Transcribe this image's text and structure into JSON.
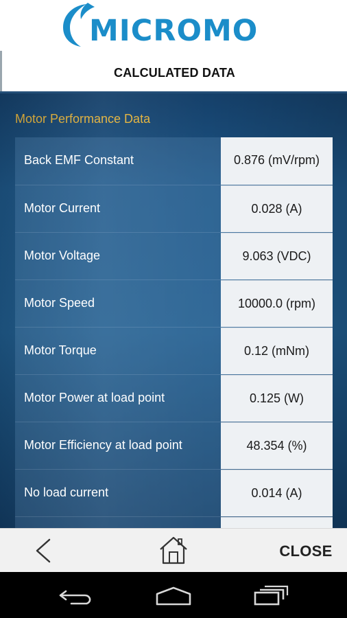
{
  "header": {
    "logo_text": "MICROMO",
    "brand_color": "#1b8dc9"
  },
  "titlebar": {
    "title": "CALCULATED DATA"
  },
  "section": {
    "title": "Motor Performance Data",
    "title_color": "#e4b33c"
  },
  "rows": [
    {
      "label": "Back EMF Constant",
      "value": "0.876 (mV/rpm)"
    },
    {
      "label": "Motor Current",
      "value": "0.028 (A)"
    },
    {
      "label": "Motor Voltage",
      "value": "9.063 (VDC)"
    },
    {
      "label": "Motor Speed",
      "value": "10000.0 (rpm)"
    },
    {
      "label": "Motor Torque",
      "value": "0.12 (mNm)"
    },
    {
      "label": "Motor Power at load point",
      "value": "0.125 (W)"
    },
    {
      "label": "Motor Efficiency at load point",
      "value": "48.354 (%)"
    },
    {
      "label": "No load current",
      "value": "0.014 (A)"
    },
    {
      "label": "",
      "value": ""
    }
  ],
  "bottombar": {
    "back_icon": "chevron-left-icon",
    "home_icon": "house-icon",
    "close_label": "CLOSE"
  },
  "navbar": {
    "icons": [
      "nav-back-icon",
      "nav-home-icon",
      "nav-recent-apps-icon"
    ]
  }
}
